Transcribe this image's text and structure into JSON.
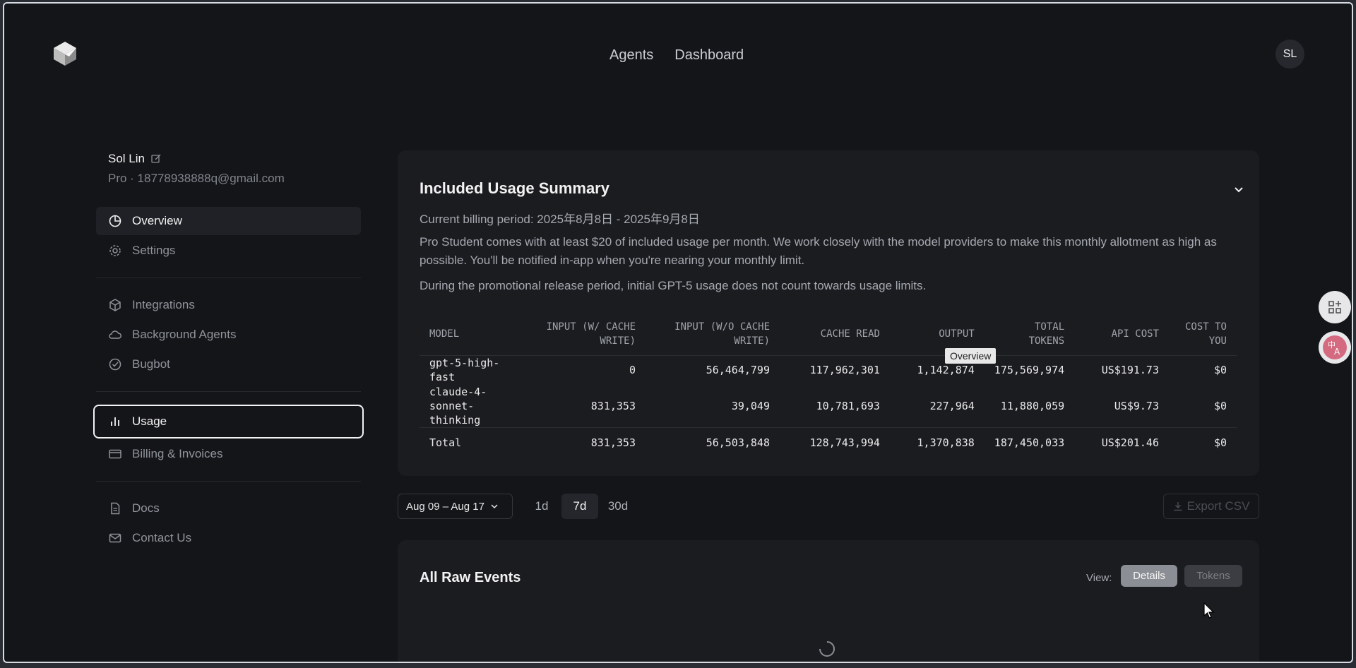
{
  "topnav": {
    "agents": "Agents",
    "dashboard": "Dashboard"
  },
  "avatar": "SL",
  "user": {
    "name": "Sol Lin",
    "sub": "Pro · 18778938888q@gmail.com"
  },
  "sidebar": {
    "overview": "Overview",
    "settings": "Settings",
    "integrations": "Integrations",
    "background_agents": "Background Agents",
    "bugbot": "Bugbot",
    "usage": "Usage",
    "billing": "Billing & Invoices",
    "docs": "Docs",
    "contact": "Contact Us"
  },
  "summary": {
    "title": "Included Usage Summary",
    "billing_period": "Current billing period: 2025年8月8日 - 2025年9月8日",
    "description": "Pro Student comes with at least $20 of included usage per month. We work closely with the model providers to make this monthly allotment as high as possible. You'll be notified in-app when you're nearing your monthly limit.",
    "promo": "During the promotional release period, initial GPT-5 usage does not count towards usage limits.",
    "headers": {
      "model": "MODEL",
      "input_cache_write": "INPUT (W/ CACHE WRITE)",
      "input_no_cache": "INPUT (W/O CACHE WRITE)",
      "cache_read": "CACHE READ",
      "output": "OUTPUT",
      "total_tokens": "TOTAL TOKENS",
      "api_cost": "API COST",
      "cost_to_you": "COST TO YOU"
    },
    "rows": [
      {
        "model": "gpt-5-high-fast",
        "input_cw": "0",
        "input_ncw": "56,464,799",
        "cache_read": "117,962,301",
        "output": "1,142,874",
        "total": "175,569,974",
        "api_cost": "US$191.73",
        "cost_you": "$0"
      },
      {
        "model": "claude-4-sonnet-thinking",
        "input_cw": "831,353",
        "input_ncw": "39,049",
        "cache_read": "10,781,693",
        "output": "227,964",
        "total": "11,880,059",
        "api_cost": "US$9.73",
        "cost_you": "$0"
      }
    ],
    "total": {
      "label": "Total",
      "input_cw": "831,353",
      "input_ncw": "56,503,848",
      "cache_read": "128,743,994",
      "output": "1,370,838",
      "total": "187,450,033",
      "api_cost": "US$201.46",
      "cost_you": "$0"
    }
  },
  "tooltip": "Overview",
  "filters": {
    "date_range": "Aug 09 – Aug 17",
    "range_1d": "1d",
    "range_7d": "7d",
    "range_30d": "30d",
    "selected_range": "7d",
    "export": "Export CSV"
  },
  "raw_events": {
    "title": "All Raw Events",
    "view_label": "View:",
    "details": "Details",
    "tokens": "Tokens"
  },
  "icons": [
    "logo-cube-icon",
    "edit-icon",
    "pie-chart-icon",
    "gear-icon",
    "cube-icon",
    "cloud-icon",
    "check-circle-icon",
    "bar-chart-icon",
    "credit-card-icon",
    "document-icon",
    "mail-icon",
    "chevron-down-icon",
    "download-icon",
    "spinner-icon",
    "apps-icon",
    "translate-icon",
    "cursor-icon"
  ]
}
